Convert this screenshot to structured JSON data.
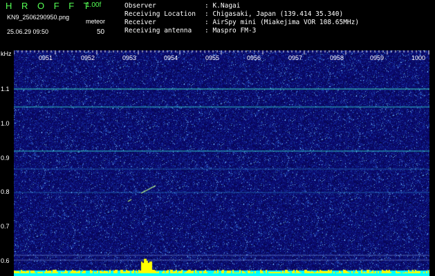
{
  "header": {
    "brand": "H R O F F T",
    "version": "1.00f",
    "filename": "KN9_2506290950.png",
    "meteor_label": "meteor",
    "datetime": "25.06.29 09:50",
    "meteor_count": "50",
    "info_lines": [
      {
        "label": "Observer",
        "value": "K.Nagai"
      },
      {
        "label": "Receiving Location",
        "value": "Chigasaki, Japan (139.414 35.340)"
      },
      {
        "label": "Receiver",
        "value": "AirSpy mini (Miakejima VOR 108.65MHz)"
      },
      {
        "label": "Receiving antenna",
        "value": "Maspro FM-3"
      }
    ]
  },
  "spectrogram": {
    "unit_label": "kHz",
    "time_labels": [
      "0951",
      "0952",
      "0953",
      "0954",
      "0955",
      "0956",
      "0957",
      "0958",
      "0959",
      "1000"
    ],
    "freq_labels": [
      "1.1",
      "1.0",
      "0.9",
      "0.8",
      "0.7",
      "0.6"
    ],
    "colors": {
      "background": "#0a0a6e",
      "signal": "#40e0d0",
      "activity": "#ffff00",
      "baseline": "#00ffff"
    }
  }
}
